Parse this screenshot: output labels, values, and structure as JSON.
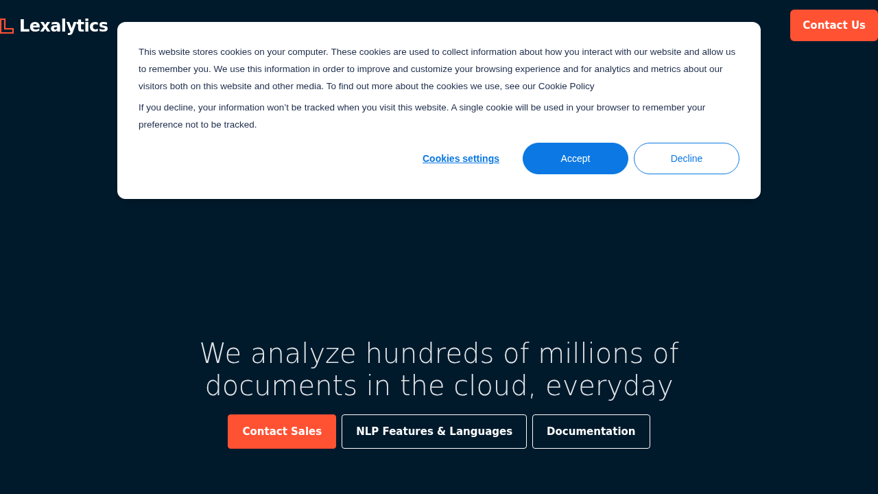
{
  "header": {
    "logo": "Lexalytics",
    "cta": "Contact Us"
  },
  "cookie_banner": {
    "paragraphs": [
      "This website stores cookies on your computer. These cookies are used to collect information about how you interact with our website and allow us to remember you. We use this information in order to improve and customize your browsing experience and for analytics and metrics about our visitors both on this website and other media. To find out more about the cookies we use, see our Cookie Policy",
      "If you decline, your information won’t be tracked when you visit this website. A single cookie will be used in your browser to remember your preference not to be tracked."
    ],
    "settings_link": "Cookies settings",
    "buttons": [
      {
        "label": "Accept",
        "kind": "primary"
      },
      {
        "label": "Decline",
        "kind": "outline"
      }
    ]
  },
  "hero": {
    "heading": "We analyze hundreds of millions of documents in the cloud, everyday",
    "buttons": [
      {
        "label": "Contact Sales",
        "kind": "primary"
      },
      {
        "label": "NLP Features & Languages",
        "kind": "outline"
      },
      {
        "label": "Documentation",
        "kind": "outline"
      }
    ]
  }
}
